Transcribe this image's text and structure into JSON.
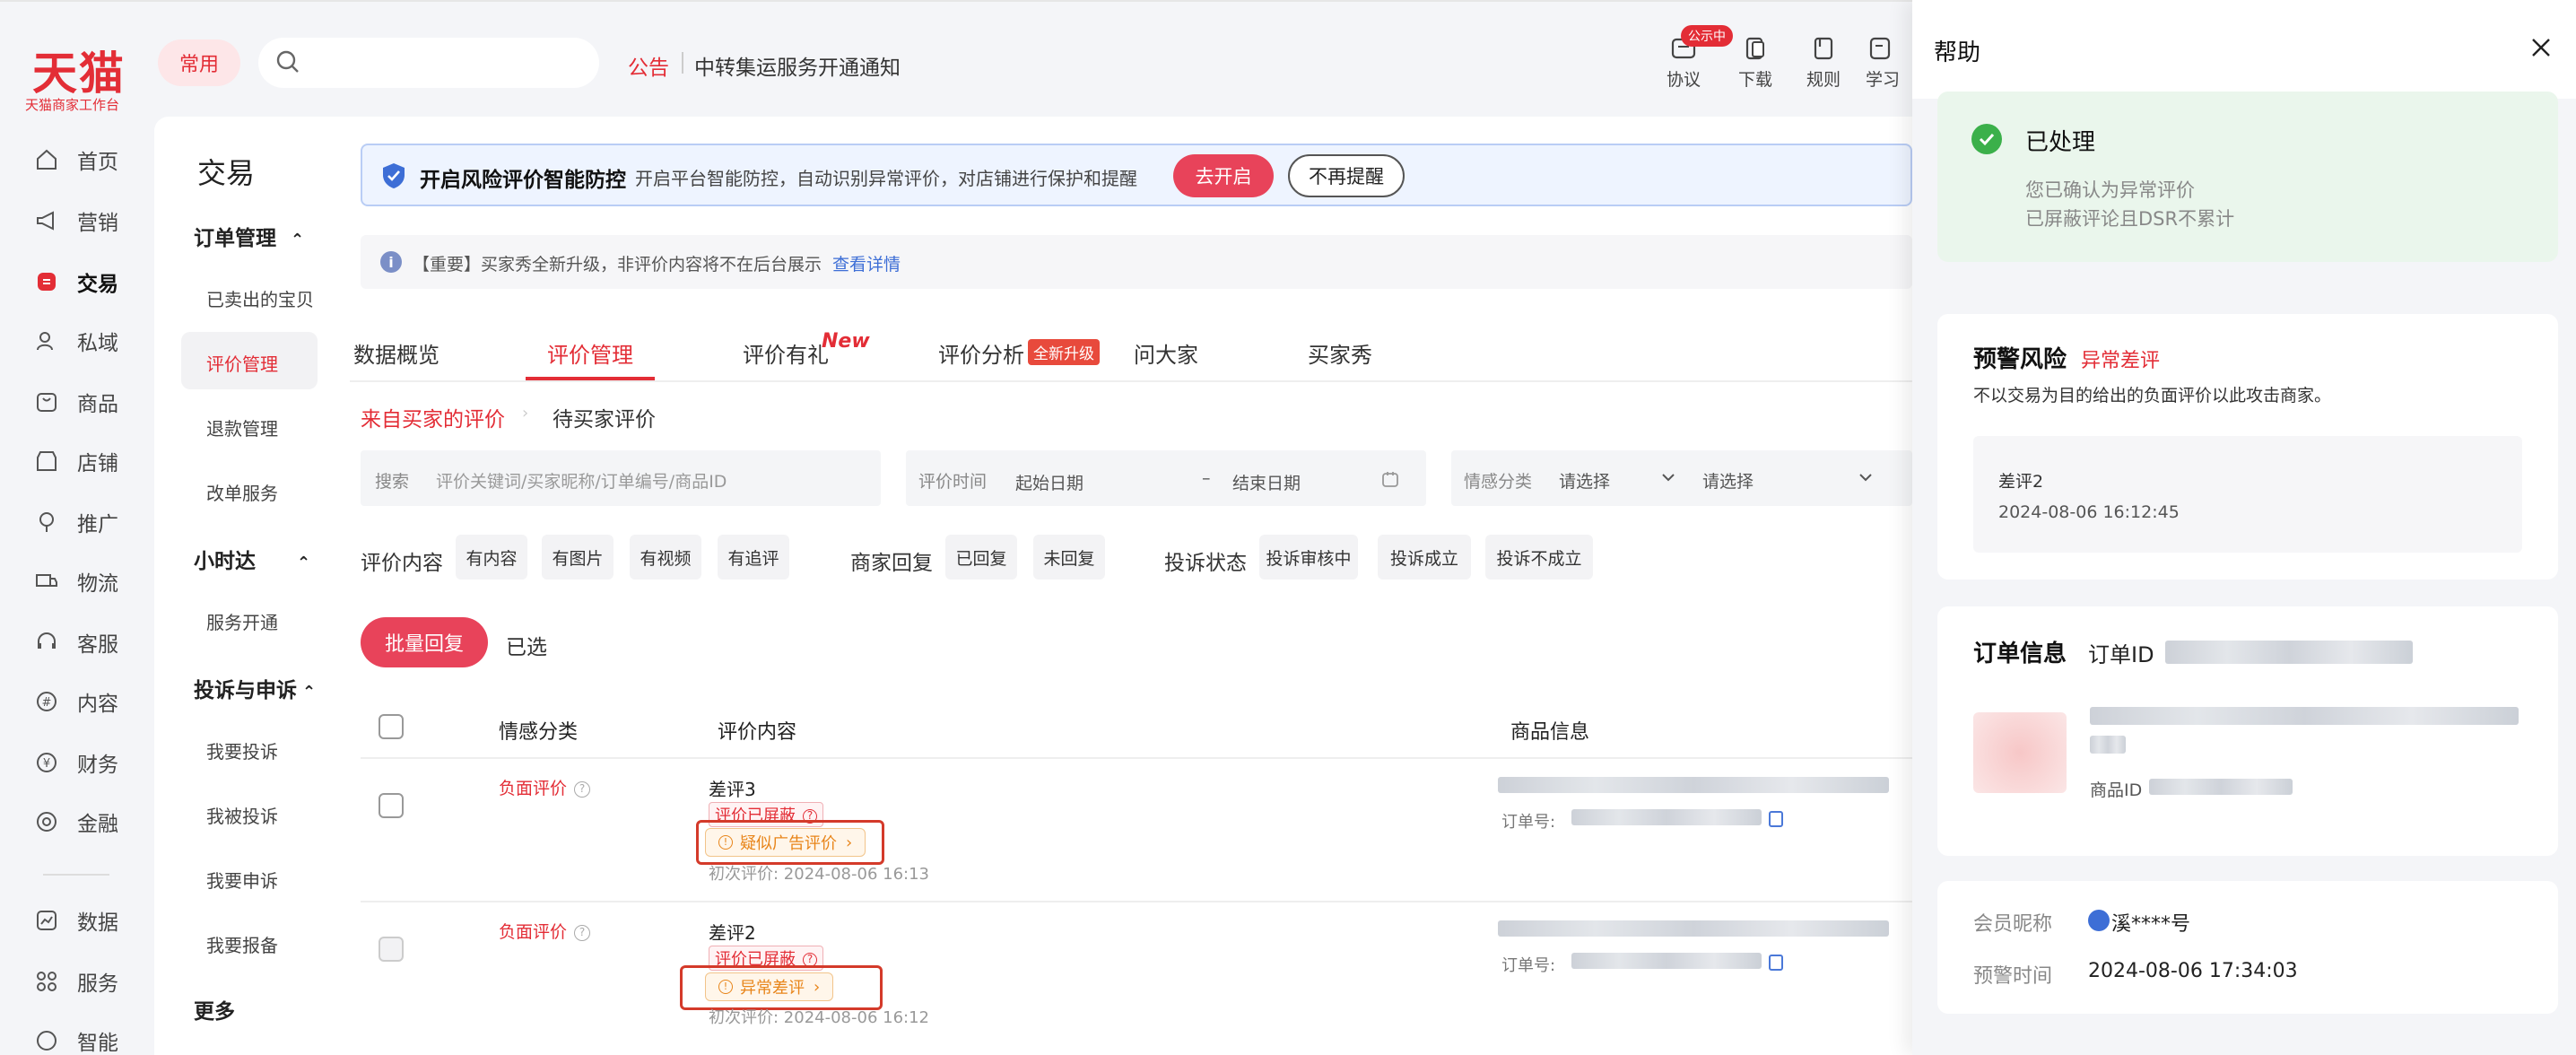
{
  "brand": {
    "name": "天猫",
    "sub": "天猫商家工作台"
  },
  "topbar": {
    "common_label": "常用",
    "search_placeholder": "",
    "notice_label": "公告",
    "notice_text": "中转集运服务开通通知",
    "icons": [
      {
        "label": "协议",
        "badge": "公示中"
      },
      {
        "label": "下载"
      },
      {
        "label": "规则"
      },
      {
        "label": "学习"
      }
    ]
  },
  "sidebar": {
    "items": [
      {
        "label": "首页",
        "icon": "home-icon"
      },
      {
        "label": "营销",
        "icon": "megaphone-icon"
      },
      {
        "label": "交易",
        "icon": "trade-icon",
        "active": true
      },
      {
        "label": "私域",
        "icon": "users-icon"
      },
      {
        "label": "商品",
        "icon": "goods-icon"
      },
      {
        "label": "店铺",
        "icon": "store-icon"
      },
      {
        "label": "推广",
        "icon": "promote-icon"
      },
      {
        "label": "物流",
        "icon": "truck-icon"
      },
      {
        "label": "客服",
        "icon": "headset-icon"
      },
      {
        "label": "内容",
        "icon": "hash-icon"
      },
      {
        "label": "财务",
        "icon": "yen-icon"
      },
      {
        "label": "金融",
        "icon": "finance-icon"
      },
      {
        "label": "数据",
        "icon": "chart-icon"
      },
      {
        "label": "服务",
        "icon": "grid-icon"
      },
      {
        "label": "智能",
        "icon": "smart-icon"
      }
    ]
  },
  "subnav": {
    "title": "交易",
    "groups": [
      {
        "label": "订单管理",
        "items": [
          "已卖出的宝贝",
          "评价管理",
          "退款管理",
          "改单服务"
        ]
      },
      {
        "label": "小时达",
        "items": [
          "服务开通"
        ]
      },
      {
        "label": "投诉与申诉",
        "items": [
          "我要投诉",
          "我被投诉",
          "我要申诉",
          "我要报备"
        ]
      },
      {
        "label": "更多",
        "items": []
      }
    ]
  },
  "risk": {
    "title": "开启风险评价智能防控",
    "desc": "开启平台智能防控，自动识别异常评价，对店铺进行保护和提醒",
    "open_label": "去开启",
    "noremind_label": "不再提醒"
  },
  "info": {
    "text": "【重要】买家秀全新升级，非评价内容将不在后台展示",
    "link": "查看详情"
  },
  "tabs": [
    {
      "label": "数据概览"
    },
    {
      "label": "评价管理",
      "active": true
    },
    {
      "label": "评价有礼",
      "tag": "New"
    },
    {
      "label": "评价分析",
      "tag": "全新升级"
    },
    {
      "label": "问大家"
    },
    {
      "label": "买家秀"
    }
  ],
  "subtabs": [
    "来自买家的评价",
    "待买家评价"
  ],
  "filters": {
    "search_label": "搜索",
    "search_placeholder": "评价关键词/买家昵称/订单编号/商品ID",
    "time_label": "评价时间",
    "start_placeholder": "起始日期",
    "dash": "–",
    "end_placeholder": "结束日期",
    "sentiment_label": "情感分类",
    "select_placeholder": "请选择",
    "select2_placeholder": "请选择"
  },
  "chips": {
    "content_label": "评价内容",
    "content": [
      "有内容",
      "有图片",
      "有视频",
      "有追评"
    ],
    "reply_label": "商家回复",
    "reply": [
      "已回复",
      "未回复"
    ],
    "complaint_label": "投诉状态",
    "complaint": [
      "投诉审核中",
      "投诉成立",
      "投诉不成立"
    ]
  },
  "actions": {
    "batch_reply": "批量回复",
    "selected": "已选"
  },
  "table": {
    "headers": [
      "情感分类",
      "评价内容",
      "商品信息"
    ],
    "rows": [
      {
        "sentiment": "负面评价",
        "title": "差评3",
        "blocked": "评价已屏蔽",
        "warn": "疑似广告评价",
        "first": "初次评价: 2024-08-06 16:13",
        "order_label": "订单号:"
      },
      {
        "sentiment": "负面评价",
        "title": "差评2",
        "blocked": "评价已屏蔽",
        "warn": "异常差评",
        "first": "初次评价: 2024-08-06 16:12",
        "order_label": "订单号:"
      }
    ]
  },
  "help": {
    "title": "帮助",
    "status": "已处理",
    "status_lines": [
      "您已确认为异常评价",
      "已屏蔽评论且DSR不累计"
    ],
    "risk_title": "预警风险",
    "risk_tag": "异常差评",
    "risk_desc": "不以交易为目的给出的负面评价以此攻击商家。",
    "review_title": "差评2",
    "review_time": "2024-08-06 16:12:45",
    "order_title": "订单信息",
    "order_id_label": "订单ID",
    "goods_id_label": "商品ID",
    "member_label": "会员昵称",
    "member_value": "溪****号",
    "alert_label": "预警时间",
    "alert_value": "2024-08-06 17:34:03"
  },
  "colors": {
    "accent": "#e32d36",
    "success": "#3bb04a",
    "warn": "#e8851a",
    "link": "#3d6ed6"
  }
}
